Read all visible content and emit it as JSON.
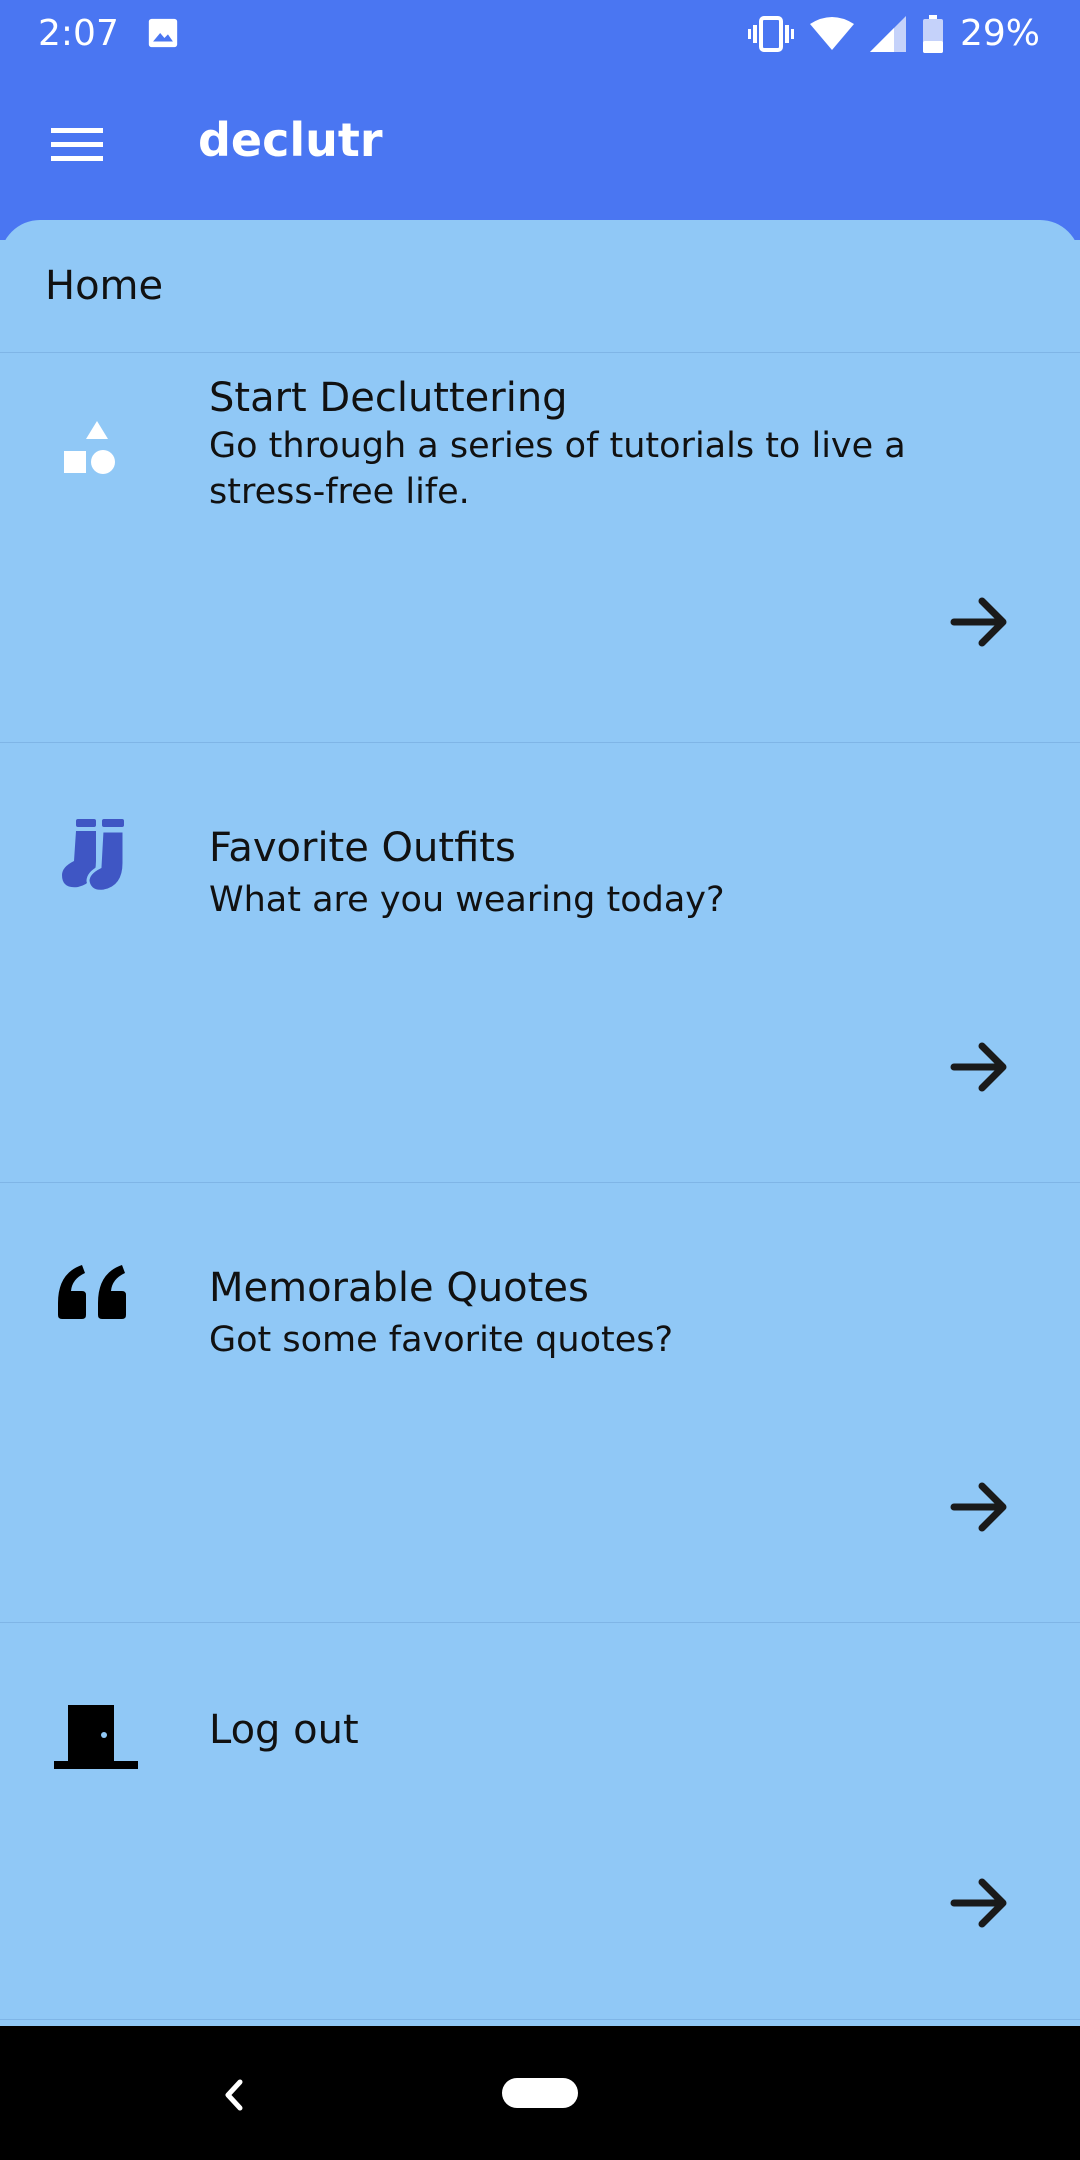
{
  "status_bar": {
    "time": "2:07",
    "battery_percent": "29%",
    "icons": [
      "image-icon",
      "vibrate-icon",
      "wifi-icon",
      "signal-icon",
      "battery-icon"
    ]
  },
  "app_bar": {
    "title": "declutr",
    "color": "#4a76f2",
    "menu_icon": "hamburger-menu-icon"
  },
  "main": {
    "background_color": "#90c8f6",
    "section_header": "Home",
    "cards": [
      {
        "icon": "shapes-icon",
        "title": "Start Decluttering",
        "subtitle": "Go through a series of tutorials to live a stress-free life."
      },
      {
        "icon": "socks-icon",
        "title": "Favorite Outfits",
        "subtitle": "What are you wearing today?"
      },
      {
        "icon": "quote-icon",
        "title": "Memorable Quotes",
        "subtitle": "Got some favorite quotes?"
      },
      {
        "icon": "door-icon",
        "title": "Log out",
        "subtitle": ""
      }
    ],
    "arrow_icon": "arrow-right-icon"
  },
  "nav_bar": {
    "icons": [
      "back-icon",
      "home-pill-icon"
    ]
  }
}
